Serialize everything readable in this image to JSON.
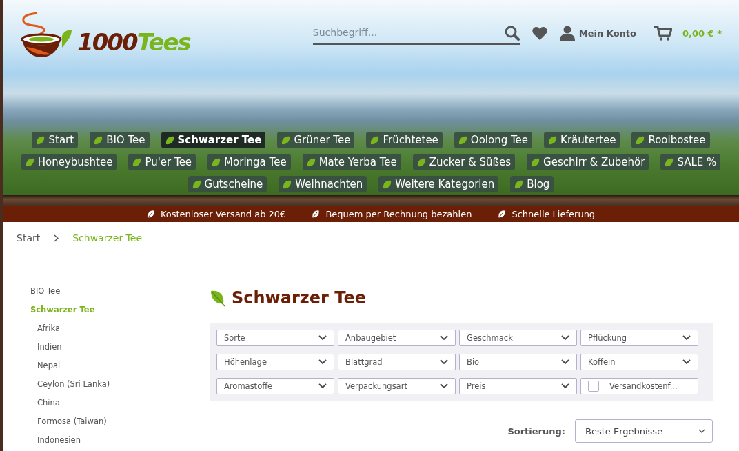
{
  "logo": {
    "number": "1000",
    "word": "Tees"
  },
  "search": {
    "placeholder": "Suchbegriff..."
  },
  "account": {
    "label": "Mein Konto"
  },
  "cart": {
    "total": "0,00 € *"
  },
  "nav": {
    "items": [
      {
        "label": "Start",
        "selected": false
      },
      {
        "label": "BIO Tee",
        "selected": false
      },
      {
        "label": "Schwarzer Tee",
        "selected": true
      },
      {
        "label": "Grüner Tee",
        "selected": false
      },
      {
        "label": "Früchtetee",
        "selected": false
      },
      {
        "label": "Oolong Tee",
        "selected": false
      },
      {
        "label": "Kräutertee",
        "selected": false
      },
      {
        "label": "Rooibostee",
        "selected": false
      },
      {
        "label": "Honeybushtee",
        "selected": false
      },
      {
        "label": "Pu'er Tee",
        "selected": false
      },
      {
        "label": "Moringa Tee",
        "selected": false
      },
      {
        "label": "Mate Yerba Tee",
        "selected": false
      },
      {
        "label": "Zucker & Süßes",
        "selected": false
      },
      {
        "label": "Geschirr & Zubehör",
        "selected": false
      },
      {
        "label": "SALE %",
        "selected": false
      },
      {
        "label": "Gutscheine",
        "selected": false
      },
      {
        "label": "Weihnachten",
        "selected": false
      },
      {
        "label": "Weitere Kategorien",
        "selected": false
      },
      {
        "label": "Blog",
        "selected": false
      }
    ]
  },
  "usp_bar": [
    "Kostenloser Versand ab 20€",
    "Bequem per Rechnung bezahlen",
    "Schnelle Lieferung"
  ],
  "breadcrumb": [
    {
      "label": "Start",
      "selected": false
    },
    {
      "label": "Schwarzer Tee",
      "selected": true
    }
  ],
  "sidebar": {
    "items": [
      {
        "label": "BIO Tee",
        "selected": false
      },
      {
        "label": "Schwarzer Tee",
        "selected": true,
        "children": [
          {
            "label": "Afrika",
            "selected": false
          },
          {
            "label": "Indien",
            "selected": false
          },
          {
            "label": "Nepal",
            "selected": false
          },
          {
            "label": "Ceylon (Sri Lanka)",
            "selected": false
          },
          {
            "label": "China",
            "selected": false
          },
          {
            "label": "Formosa (Taiwan)",
            "selected": false
          },
          {
            "label": "Indonesien",
            "selected": false
          }
        ]
      }
    ]
  },
  "page_title": "Schwarzer Tee",
  "filters": [
    {
      "kind": "select",
      "label": "Sorte"
    },
    {
      "kind": "select",
      "label": "Anbaugebiet"
    },
    {
      "kind": "select",
      "label": "Geschmack"
    },
    {
      "kind": "select",
      "label": "Pflückung"
    },
    {
      "kind": "select",
      "label": "Höhenlage"
    },
    {
      "kind": "select",
      "label": "Blattgrad"
    },
    {
      "kind": "select",
      "label": "Bio"
    },
    {
      "kind": "select",
      "label": "Koffein"
    },
    {
      "kind": "select",
      "label": "Aromastoffe"
    },
    {
      "kind": "select",
      "label": "Verpackungsart"
    },
    {
      "kind": "select",
      "label": "Preis"
    },
    {
      "kind": "checkbox",
      "label": "Versandkostenf...",
      "checked": false
    }
  ],
  "sorting": {
    "label": "Sortierung:",
    "value": "Beste Ergebnisse"
  }
}
